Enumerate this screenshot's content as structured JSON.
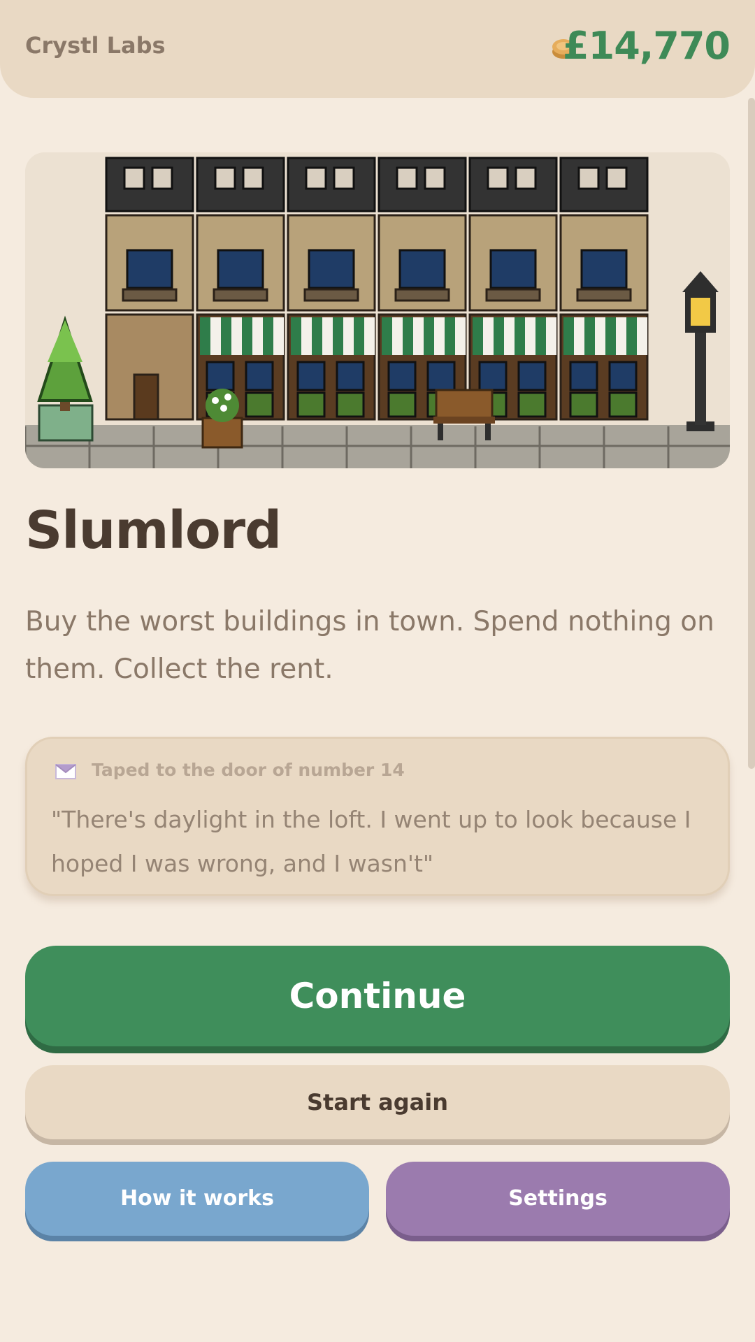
{
  "header": {
    "brand": "Crystl Labs",
    "coin_icon": "coin-icon",
    "balance": "£14,770"
  },
  "hero": {
    "icon": "pixel-street-scene",
    "storefronts": 6,
    "colors": {
      "awning": "#2f7d4a",
      "stone": "#b8a27a",
      "roof": "#333333"
    }
  },
  "game": {
    "title": "Slumlord",
    "description": "Buy the worst buildings in town. Spend nothing on them. Collect the rent."
  },
  "note": {
    "icon": "envelope-icon",
    "label": "Taped to the door of number 14",
    "text": "\"There's daylight in the loft. I went up to look because I hoped I was wrong, and I wasn't\""
  },
  "buttons": {
    "continue": "Continue",
    "start_again": "Start again",
    "how_it_works": "How it works",
    "settings": "Settings"
  },
  "colors": {
    "accent_green": "#3f8e5b",
    "blue": "#79a7ce",
    "purple": "#9b7bae",
    "beige": "#e9d9c4"
  }
}
